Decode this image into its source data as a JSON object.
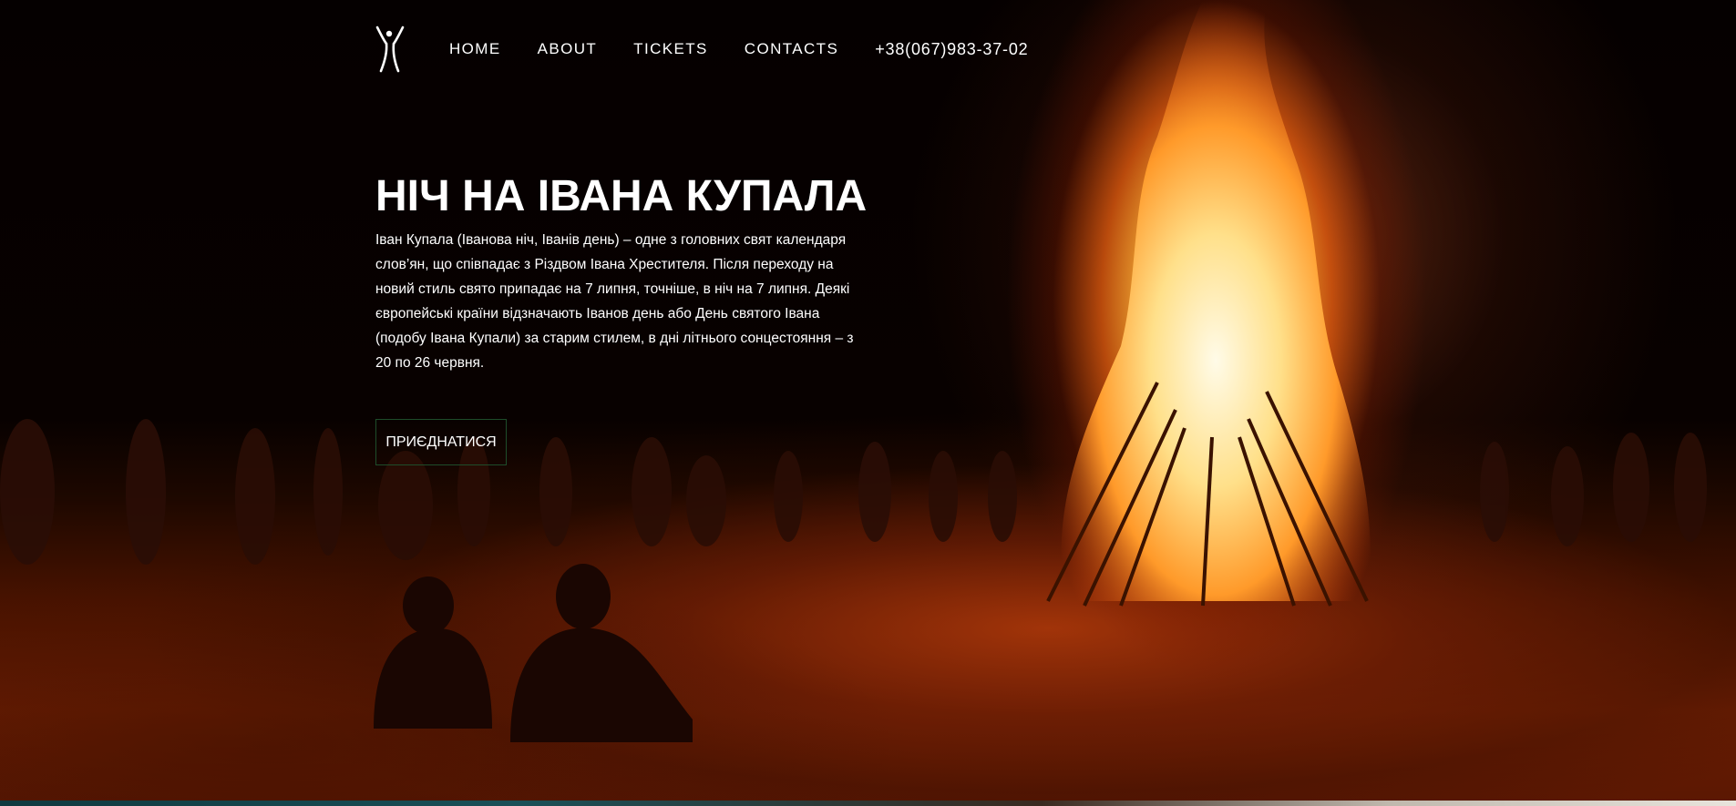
{
  "nav": {
    "items": [
      {
        "label": "HOME"
      },
      {
        "label": "ABOUT"
      },
      {
        "label": "TICKETS"
      },
      {
        "label": "CONTACTS"
      }
    ],
    "phone": "+38(067)983-37-02"
  },
  "hero": {
    "title": "НІЧ НА ІВАНА КУПАЛА",
    "description": "Іван Купала (Іванова ніч, Іванів день) – одне з головних свят календаря слов’ян, що співпадає з Різдвом Івана Хрестителя. Після переходу на новий стиль свято припадає на 7 липня, точніше, в ніч на 7 липня. Деякі європейські країни відзначають Іванов день або День святого Івана (подобу Івана Купали) за старим стилем, в дні літнього сонцестояння – з 20 по 26 червня.",
    "button_label": "ПРИЄДНАТИСЯ"
  },
  "icons": {
    "logo": "human-figure-logo-icon"
  },
  "colors": {
    "text": "#ffffff",
    "button_border": "#1e4d2a",
    "fire": "#ffb43c"
  }
}
